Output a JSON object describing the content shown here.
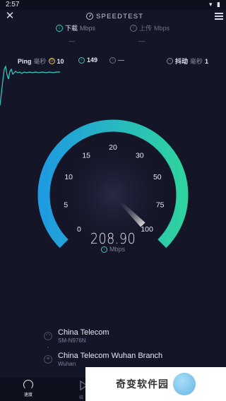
{
  "status_bar": {
    "time": "2:57",
    "icons": "▾ ▮"
  },
  "header": {
    "close_icon": "close-icon",
    "title": "SPEEDTEST",
    "menu_icon": "hamburger-menu-icon"
  },
  "download": {
    "label": "下载",
    "unit": "Mbps",
    "value": "—"
  },
  "upload": {
    "label": "上传",
    "unit": "Mbps",
    "value": "—"
  },
  "ping": {
    "label": "Ping",
    "unit": "毫秒",
    "idle_value": "10",
    "download_value": "149",
    "upload_value": "—"
  },
  "jitter": {
    "label": "抖动",
    "unit": "毫秒",
    "value": "1"
  },
  "gauge": {
    "ticks": [
      "0",
      "5",
      "10",
      "15",
      "20",
      "30",
      "50",
      "75",
      "100"
    ],
    "speed": "208.90",
    "unit": "Mbps",
    "needle_value": 100,
    "colors": {
      "start": "#1f9be0",
      "end": "#2fd3a0"
    }
  },
  "server": {
    "isp_name": "China Telecom",
    "device": "SM-N976N",
    "host_name": "China Telecom Wuhan Branch",
    "host_location": "Wuhan"
  },
  "tabs": {
    "speed_label": "速度",
    "results_label": "结"
  },
  "watermark": {
    "text": "奇变软件园"
  }
}
